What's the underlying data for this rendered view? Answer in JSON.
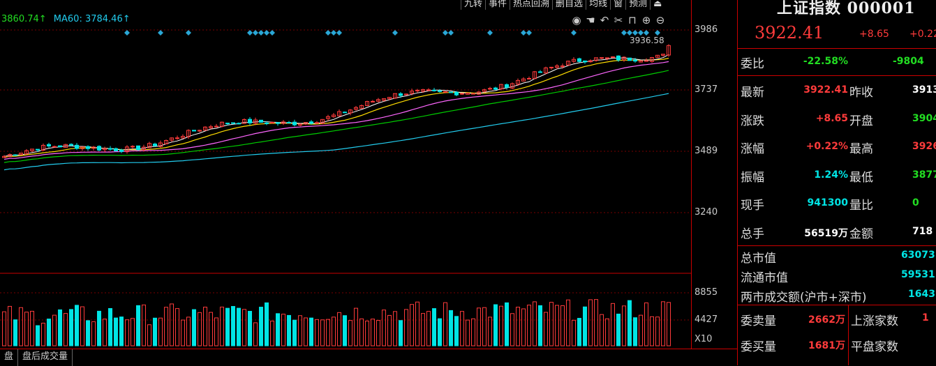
{
  "toolbar": {
    "items": [
      "九转",
      "事件",
      "热点回溯",
      "删自选",
      "均线",
      "窗",
      "预测",
      "⏏"
    ]
  },
  "legend": {
    "ma_a": "3860.74↑",
    "ma60": "MA60: 3784.46↑"
  },
  "icons": [
    "eye-icon",
    "hand-icon",
    "undo-icon",
    "scissors-icon",
    "lock-icon",
    "zoom-in-icon",
    "zoom-out-icon"
  ],
  "axis": {
    "price_labels": [
      "3986",
      "3737",
      "3489",
      "3240"
    ],
    "vol_labels": [
      "8855",
      "4427",
      "X10"
    ]
  },
  "chart_data": {
    "type": "candlestick",
    "high_annotation": "3936.58",
    "price_ticks": [
      3986,
      3737,
      3489,
      3240
    ],
    "volume_ticks": [
      8855,
      4427
    ],
    "volume_unit_label": "X10"
  },
  "colors": {
    "up": "#ff3b3b",
    "down": "#00e5e5",
    "ma5": "#ffffff",
    "ma10": "#ffdd00",
    "ma20": "#ff66ff",
    "ma30": "#00cc00",
    "ma60": "#22ccee",
    "signal": "#2aa7d6"
  },
  "bottom_tabs": [
    "盘",
    "盘后成交量"
  ],
  "panel": {
    "title": "上证指数 000001",
    "price": "3922.41",
    "change": "+8.65",
    "change_pct": "+0.22",
    "weibi": {
      "label": "委比",
      "v1": "-22.58%",
      "v2": "-9804"
    },
    "rows": [
      {
        "l1": "最新",
        "v1": "3922.41",
        "l2": "昨收",
        "v2": "3913"
      },
      {
        "l1": "涨跌",
        "v1": "+8.65",
        "l2": "开盘",
        "v2": "3904"
      },
      {
        "l1": "涨幅",
        "v1": "+0.22%",
        "l2": "最高",
        "v2": "3926"
      },
      {
        "l1": "振幅",
        "v1": "1.24%",
        "l2": "最低",
        "v2": "3877"
      },
      {
        "l1": "现手",
        "v1": "941300",
        "l2": "量比",
        "v2": "0"
      },
      {
        "l1": "总手",
        "v1": "56519万",
        "l2": "金额",
        "v2": "718"
      }
    ],
    "mkt": [
      {
        "label": "总市值",
        "value": "63073"
      },
      {
        "label": "流通市值",
        "value": "59531"
      },
      {
        "label": "两市成交额(沪市+深市)",
        "value": "1643"
      }
    ],
    "bottom": [
      {
        "label": "委卖量",
        "value": "2662万",
        "label2": "上涨家数",
        "value2": "1"
      },
      {
        "label": "委买量",
        "value": "1681万",
        "label2": "平盘家数",
        "value2": ""
      }
    ]
  }
}
